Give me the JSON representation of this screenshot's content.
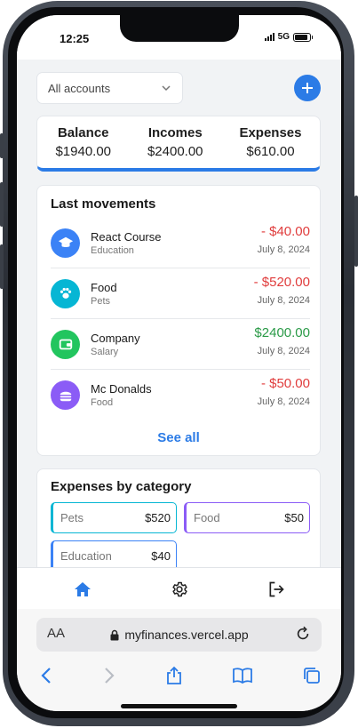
{
  "status_bar": {
    "time": "12:25",
    "network": "5G",
    "battery_level": 0.9
  },
  "toolbar": {
    "account_select": "All accounts",
    "add_icon": "plus-icon"
  },
  "summary": {
    "balance_label": "Balance",
    "balance_value": "$1940.00",
    "incomes_label": "Incomes",
    "incomes_value": "$2400.00",
    "expenses_label": "Expenses",
    "expenses_value": "$610.00"
  },
  "movements": {
    "title": "Last movements",
    "see_all": "See all",
    "items": [
      {
        "name": "React Course",
        "category": "Education",
        "amount": "- $40.00",
        "date": "July 8, 2024",
        "icon": "graduation-cap-icon",
        "color": "#3b82f6",
        "kind": "negative"
      },
      {
        "name": "Food",
        "category": "Pets",
        "amount": "- $520.00",
        "date": "July 8, 2024",
        "icon": "paw-icon",
        "color": "#06b6d4",
        "kind": "negative"
      },
      {
        "name": "Company",
        "category": "Salary",
        "amount": "$2400.00",
        "date": "July 8, 2024",
        "icon": "wallet-icon",
        "color": "#22c55e",
        "kind": "positive"
      },
      {
        "name": "Mc Donalds",
        "category": "Food",
        "amount": "- $50.00",
        "date": "July 8, 2024",
        "icon": "burger-icon",
        "color": "#8b5cf6",
        "kind": "negative"
      }
    ]
  },
  "categories": {
    "title": "Expenses by category",
    "items": [
      {
        "name": "Pets",
        "value": "$520",
        "color": "#06b6d4"
      },
      {
        "name": "Food",
        "value": "$50",
        "color": "#8b5cf6"
      },
      {
        "name": "Education",
        "value": "$40",
        "color": "#3b82f6"
      }
    ]
  },
  "tabbar": {
    "home_icon": "home-icon",
    "settings_icon": "gear-icon",
    "logout_icon": "logout-icon",
    "active_color": "#2b7be6"
  },
  "browser": {
    "text_size": "AA",
    "url": "myfinances.vercel.app"
  },
  "colors": {
    "accent": "#2b7be6",
    "negative": "#e03c3c",
    "positive": "#2a9a47"
  }
}
